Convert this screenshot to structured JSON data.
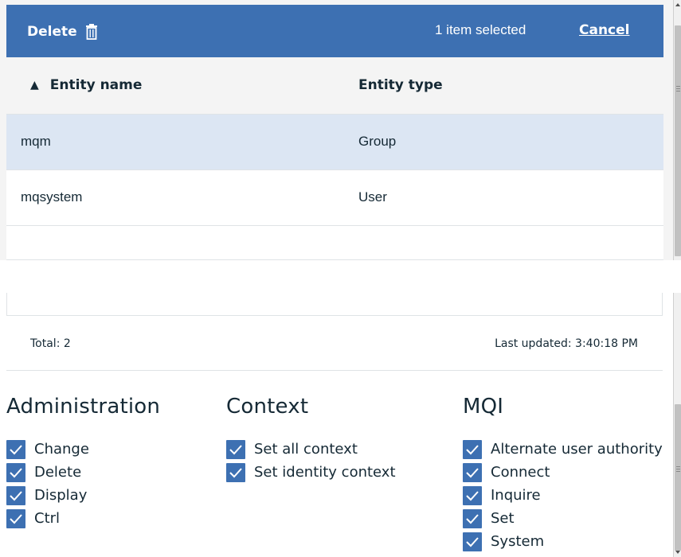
{
  "toolbar": {
    "delete_label": "Delete",
    "selected_text": "1 item selected",
    "cancel_label": "Cancel"
  },
  "table": {
    "columns": [
      {
        "label": "Entity name",
        "sort": "ascending"
      },
      {
        "label": "Entity type"
      }
    ],
    "rows": [
      {
        "name": "mqm",
        "type": "Group",
        "selected": true
      },
      {
        "name": "mqsystem",
        "type": "User",
        "selected": false
      }
    ]
  },
  "footer": {
    "total": "Total: 2",
    "last_updated": "Last updated: 3:40:18 PM"
  },
  "permissions": {
    "administration": {
      "title": "Administration",
      "items": [
        "Change",
        "Delete",
        "Display",
        "Ctrl"
      ]
    },
    "context": {
      "title": "Context",
      "items": [
        "Set all context",
        "Set identity context"
      ]
    },
    "mqi": {
      "title": "MQI",
      "items": [
        "Alternate user authority",
        "Connect",
        "Inquire",
        "Set",
        "System"
      ]
    }
  },
  "colors": {
    "accent": "#3d70b2",
    "selected_row": "#dce6f3",
    "header_bg": "#f4f4f4"
  },
  "icons": {
    "delete": "trash-icon",
    "checkbox": "checkmark-icon"
  }
}
